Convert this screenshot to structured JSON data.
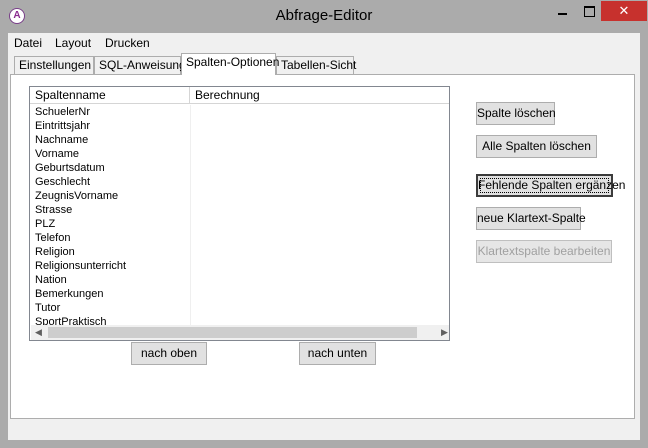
{
  "window": {
    "title": "Abfrage-Editor",
    "app_icon_letter": "A",
    "close_glyph": "✕"
  },
  "menu": {
    "items": [
      "Datei",
      "Layout",
      "Drucken"
    ]
  },
  "tabs": {
    "items": [
      "Einstellungen",
      "SQL-Anweisung",
      "Spalten-Optionen",
      "Tabellen-Sicht"
    ],
    "active": "Spalten-Optionen"
  },
  "list": {
    "columns": [
      "Spaltenname",
      "Berechnung"
    ],
    "rows": [
      [
        "SchuelerNr",
        ""
      ],
      [
        "Eintrittsjahr",
        ""
      ],
      [
        "Nachname",
        ""
      ],
      [
        "Vorname",
        ""
      ],
      [
        "Geburtsdatum",
        ""
      ],
      [
        "Geschlecht",
        ""
      ],
      [
        "ZeugnisVorname",
        ""
      ],
      [
        "Strasse",
        ""
      ],
      [
        "PLZ",
        ""
      ],
      [
        "Telefon",
        ""
      ],
      [
        "Religion",
        ""
      ],
      [
        "Religionsunterricht",
        ""
      ],
      [
        "Nation",
        ""
      ],
      [
        "Bemerkungen",
        ""
      ],
      [
        "Tutor",
        ""
      ],
      [
        "SportPraktisch",
        ""
      ]
    ]
  },
  "buttons": {
    "delete_column": "Spalte löschen",
    "delete_all_columns": "Alle Spalten löschen",
    "add_missing_columns": "Fehlende Spalten ergänzen",
    "new_plaintext_column": "neue Klartext-Spalte",
    "edit_plaintext_column": "Klartextspalte bearbeiten",
    "move_up": "nach oben",
    "move_down": "nach unten"
  },
  "icons": {
    "scroll_up": "▲",
    "scroll_down": "▼",
    "scroll_left": "◀",
    "scroll_right": "▶"
  },
  "colors": {
    "close_button": "#c7312d",
    "titlebar": "#ababab"
  }
}
